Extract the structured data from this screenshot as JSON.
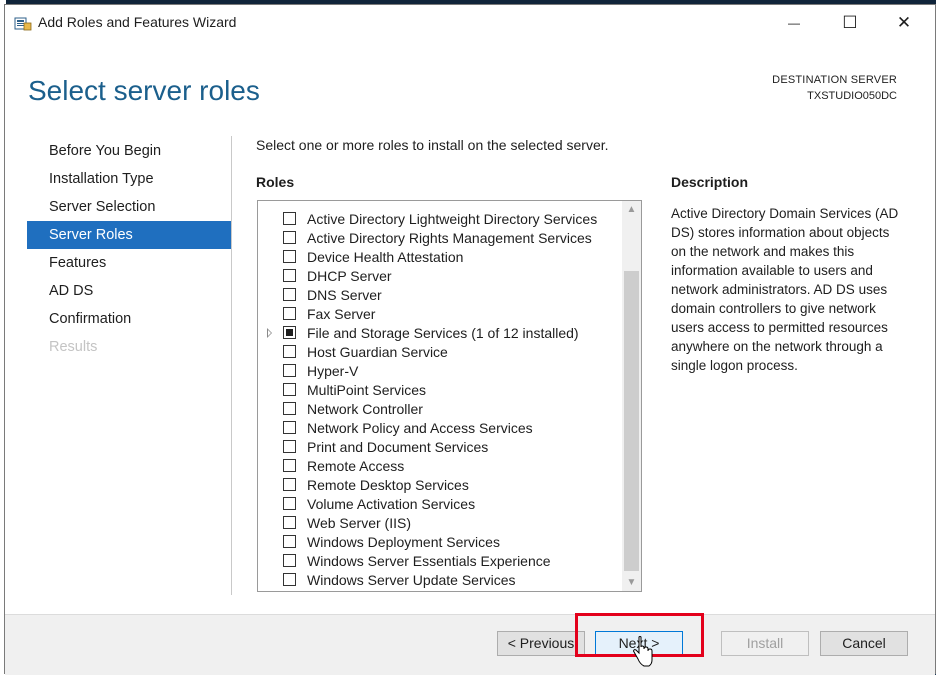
{
  "window": {
    "title": "Add Roles and Features Wizard",
    "minimize_glyph": "—",
    "maximize_glyph": "☐",
    "close_glyph": "✕"
  },
  "header": {
    "page_title": "Select server roles",
    "destination_label": "DESTINATION SERVER",
    "destination_name": "TXSTUDIO050DC"
  },
  "nav": {
    "items": [
      {
        "label": "Before You Begin",
        "state": "normal"
      },
      {
        "label": "Installation Type",
        "state": "normal"
      },
      {
        "label": "Server Selection",
        "state": "normal"
      },
      {
        "label": "Server Roles",
        "state": "active"
      },
      {
        "label": "Features",
        "state": "normal"
      },
      {
        "label": "AD DS",
        "state": "normal"
      },
      {
        "label": "Confirmation",
        "state": "normal"
      },
      {
        "label": "Results",
        "state": "disabled"
      }
    ]
  },
  "main": {
    "instruction": "Select one or more roles to install on the selected server.",
    "roles_heading": "Roles",
    "description_heading": "Description",
    "description_text": "Active Directory Domain Services (AD DS) stores information about objects on the network and makes this information available to users and network administrators. AD DS uses domain controllers to give network users access to permitted resources anywhere on the network through a single logon process.",
    "roles": [
      {
        "label": "Active Directory Lightweight Directory Services",
        "checked": false
      },
      {
        "label": "Active Directory Rights Management Services",
        "checked": false
      },
      {
        "label": "Device Health Attestation",
        "checked": false
      },
      {
        "label": "DHCP Server",
        "checked": false
      },
      {
        "label": "DNS Server",
        "checked": false
      },
      {
        "label": "Fax Server",
        "checked": false
      },
      {
        "label": "File and Storage Services (1 of 12 installed)",
        "checked": "partial",
        "expandable": true
      },
      {
        "label": "Host Guardian Service",
        "checked": false
      },
      {
        "label": "Hyper-V",
        "checked": false
      },
      {
        "label": "MultiPoint Services",
        "checked": false
      },
      {
        "label": "Network Controller",
        "checked": false
      },
      {
        "label": "Network Policy and Access Services",
        "checked": false
      },
      {
        "label": "Print and Document Services",
        "checked": false
      },
      {
        "label": "Remote Access",
        "checked": false
      },
      {
        "label": "Remote Desktop Services",
        "checked": false
      },
      {
        "label": "Volume Activation Services",
        "checked": false
      },
      {
        "label": "Web Server (IIS)",
        "checked": false
      },
      {
        "label": "Windows Deployment Services",
        "checked": false
      },
      {
        "label": "Windows Server Essentials Experience",
        "checked": false
      },
      {
        "label": "Windows Server Update Services",
        "checked": false
      }
    ]
  },
  "footer": {
    "previous_label": "< Previous",
    "next_label": "Next >",
    "install_label": "Install",
    "cancel_label": "Cancel"
  },
  "colors": {
    "title_blue": "#1b5f8c",
    "nav_active": "#1f6fbf",
    "highlight_red": "#e3001b"
  }
}
